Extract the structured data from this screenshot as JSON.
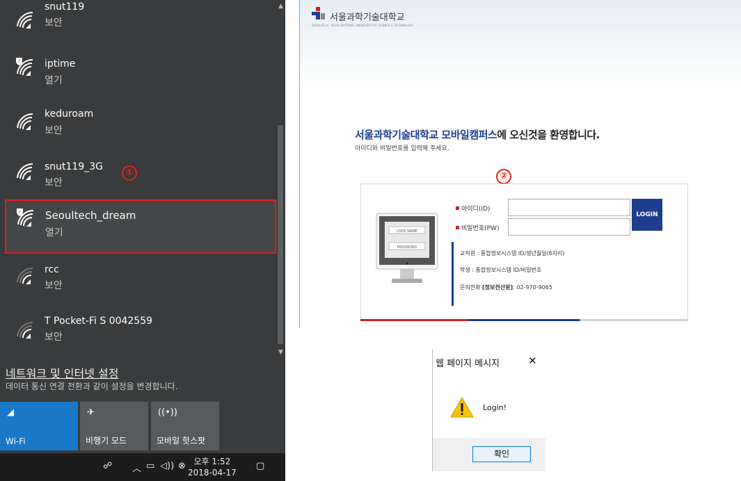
{
  "wifi": {
    "networks": [
      {
        "name": "snut119",
        "status": "보안"
      },
      {
        "name": "iptime",
        "status": "열기"
      },
      {
        "name": "keduroam",
        "status": "보안"
      },
      {
        "name": "snut119_3G",
        "status": "보안"
      },
      {
        "name": "Seoultech_dream",
        "status": "열기"
      },
      {
        "name": "rcc",
        "status": "보안"
      },
      {
        "name": "T Pocket-Fi S 0042559",
        "status": "보안"
      }
    ],
    "marker": "①",
    "settings_link": "네트워크 및 인터넷 설정",
    "settings_desc": "데이터 통신 연결 전환과 같이 설정을 변경합니다.",
    "tiles": {
      "wifi": "Wi-Fi",
      "airplane": "비행기 모드",
      "hotspot": "모바일 핫스팟"
    },
    "taskbar": {
      "time": "오후 1:52",
      "date": "2018-04-17"
    },
    "colors": {
      "panel": "#3a3b3c",
      "accent": "#1a78c8",
      "highlight": "#e0201e"
    }
  },
  "web": {
    "logo_text": "서울과학기술대학교",
    "logo_sub": "SEOULTECH · SEOUL NATIONAL UNIVERSITY OF SCIENCE & TECHNOLOGY",
    "welcome_hl": "서울과학기술대학교 모바일캠퍼스",
    "welcome_rest": "에 오신것을 환영합니다.",
    "welcome_sub": "아이디와 비밀번호를 입력해 주세요.",
    "marker": "②",
    "id_label": "아이디(ID)",
    "pw_label": "비밀번호(PW)",
    "login_button": "LOGIN",
    "monitor_user": "USER NAME",
    "monitor_pass": "PASSWORD",
    "info_staff": "교직원 : 통합정보시스템 ID/생년월일(6자리)",
    "info_student": "학생 : 통합정보시스템 ID/비밀번호",
    "info_contact_prefix": "문의전화",
    "info_contact_bold": "[정보전산원]",
    "info_contact_number": ": 02-970-9065",
    "colors": {
      "navy": "#1e3d8f",
      "red": "#c8232c"
    }
  },
  "dialog": {
    "title": "웹 페이지 메시지",
    "close": "✕",
    "message": "Login!",
    "ok": "확인"
  }
}
